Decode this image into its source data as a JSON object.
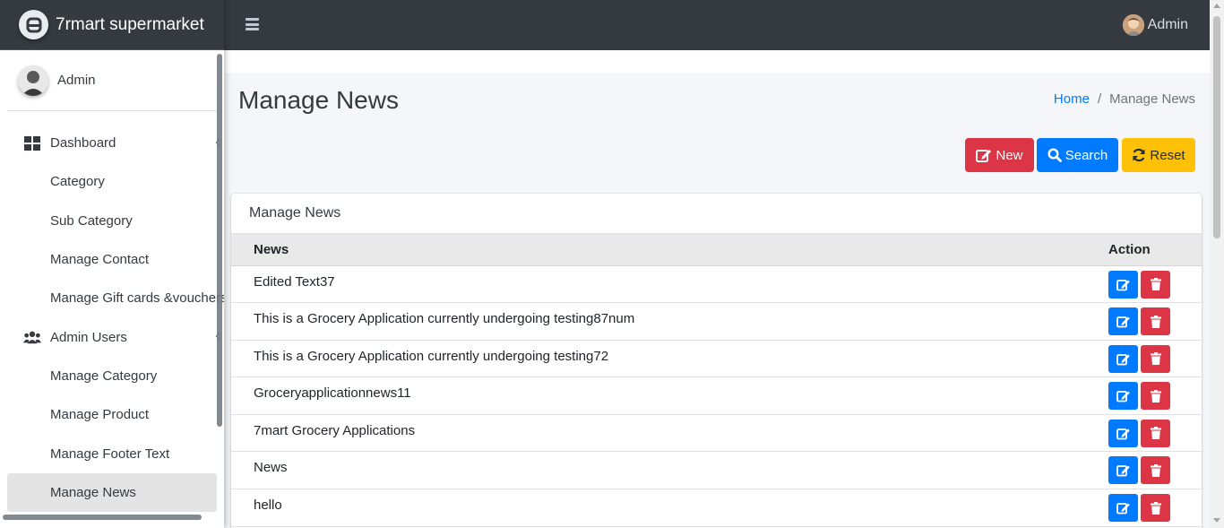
{
  "brand": {
    "name": "7rmart supermarket",
    "icon": "brand-logo-icon"
  },
  "sidebar": {
    "user_name": "Admin",
    "items": [
      {
        "label": "Dashboard",
        "icon": "dashboard-icon",
        "top": true,
        "expandable": true
      },
      {
        "label": "Category"
      },
      {
        "label": "Sub Category"
      },
      {
        "label": "Manage Contact"
      },
      {
        "label": "Manage Gift cards &vouchers"
      },
      {
        "label": "Admin Users",
        "icon": "users-icon",
        "top": true,
        "expandable": true
      },
      {
        "label": "Manage Category"
      },
      {
        "label": "Manage Product"
      },
      {
        "label": "Manage Footer Text"
      },
      {
        "label": "Manage News",
        "active": true
      }
    ]
  },
  "topbar": {
    "menu_icon": "hamburger-icon",
    "user_name": "Admin"
  },
  "page": {
    "title": "Manage News",
    "breadcrumb": {
      "home": "Home",
      "current": "Manage News"
    }
  },
  "actions": {
    "new_label": "New",
    "search_label": "Search",
    "reset_label": "Reset"
  },
  "card": {
    "title": "Manage News",
    "columns": {
      "news": "News",
      "action": "Action"
    },
    "rows": [
      "Edited Text37",
      "This is a Grocery Application currently undergoing testing87num",
      "This is a Grocery Application currently undergoing testing72",
      "Groceryapplicationnews11",
      "7mart Grocery Applications",
      "News",
      "hello"
    ]
  },
  "colors": {
    "sidebar_bg": "#ffffff",
    "topbar_bg": "#343a40",
    "primary": "#007bff",
    "danger": "#dc3545",
    "warning": "#ffc107",
    "active_item_bg": "#e4e4e4"
  }
}
